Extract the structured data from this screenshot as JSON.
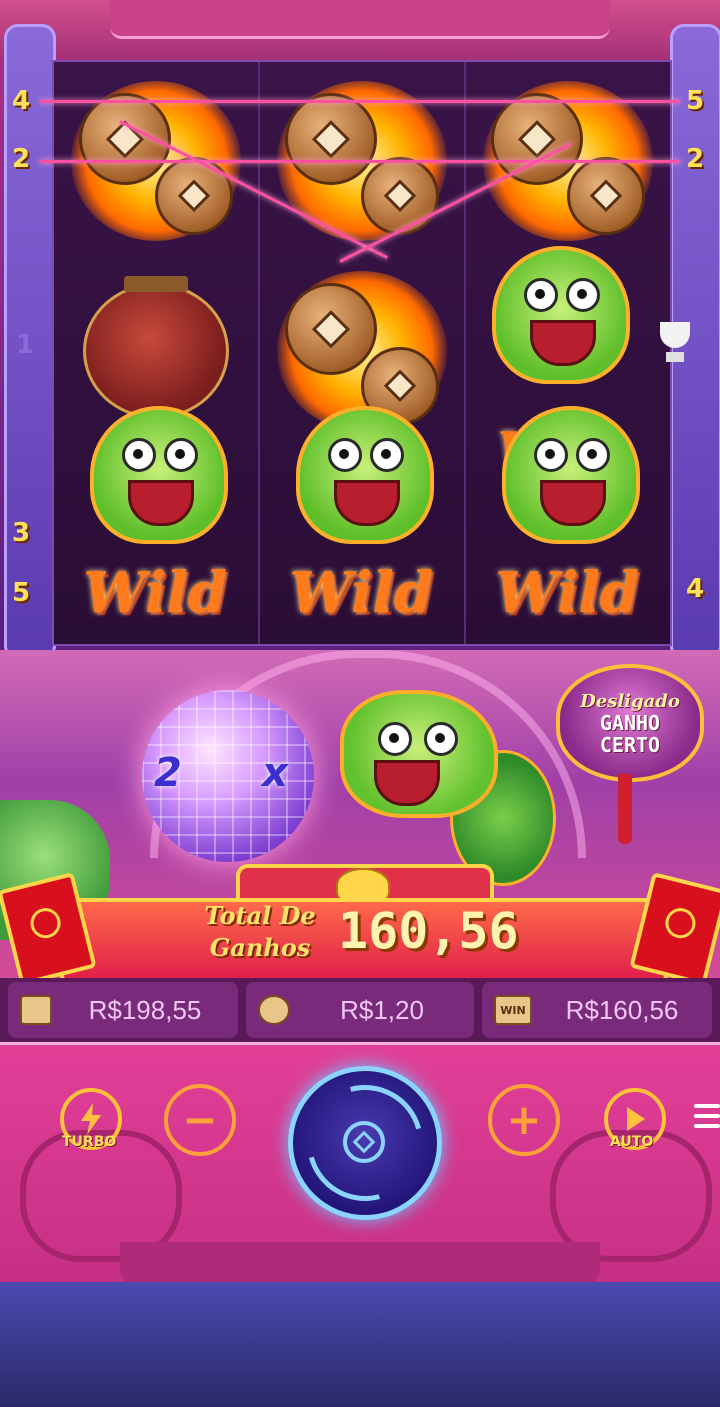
{
  "reels": {
    "paylines_left": [
      "4",
      "2",
      "1",
      "3",
      "5"
    ],
    "paylines_right": [
      "5",
      "2",
      "4"
    ],
    "symbols": [
      [
        "coin",
        "lantern",
        "wild"
      ],
      [
        "coin",
        "coin",
        "wild"
      ],
      [
        "coin",
        "wild",
        "wild"
      ]
    ],
    "wild_label": "Wild"
  },
  "feature": {
    "disco_left": "2",
    "disco_right": "x",
    "guarantee_top": "Desligado",
    "guarantee_bottom_1": "GANHO",
    "guarantee_bottom_2": "CERTO"
  },
  "win": {
    "label_1": "Total De",
    "label_2": "Ganhos",
    "amount": "160,56"
  },
  "stats": {
    "balance": "R$198,55",
    "bet": "R$1,20",
    "win": "R$160,56",
    "win_icon_text": "WIN"
  },
  "controls": {
    "turbo_label": "TURBO",
    "auto_label": "AUTO",
    "minus_glyph": "−",
    "plus_glyph": "+"
  },
  "icons": {
    "balance": "wallet-icon",
    "bet": "coin-stack-icon",
    "win": "win-badge-icon",
    "turbo": "lightning-icon",
    "auto": "play-icon",
    "menu": "hamburger-menu-icon",
    "trophy": "trophy-icon"
  },
  "colors": {
    "accent": "#ffd54a",
    "panel": "#7a2a7a",
    "wild": "#ff7a1a"
  }
}
